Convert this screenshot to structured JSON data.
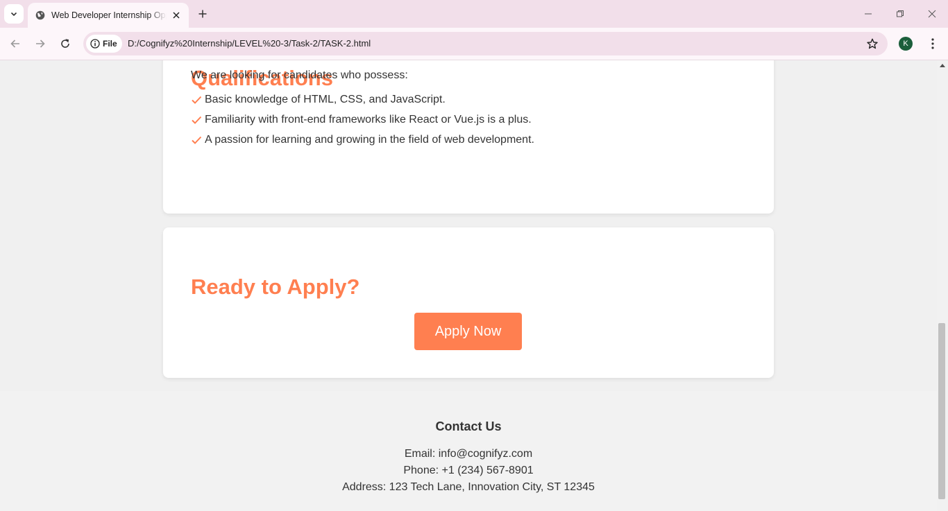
{
  "browser": {
    "tab_title": "Web Developer Internship Opportunity",
    "site_chip": "File",
    "url": "D:/Cognifyz%20Internship/LEVEL%20-3/Task-2/TASK-2.html",
    "profile_initial": "K"
  },
  "qualifications": {
    "title": "Qualifications",
    "intro": "We are looking for candidates who possess:",
    "items": [
      "Basic knowledge of HTML, CSS, and JavaScript.",
      "Familiarity with front-end frameworks like React or Vue.js is a plus.",
      "A passion for learning and growing in the field of web development."
    ]
  },
  "apply": {
    "title": "Ready to Apply?",
    "button_label": "Apply Now"
  },
  "footer": {
    "title": "Contact Us",
    "email": "Email: info@cognifyz.com",
    "phone": "Phone: +1 (234) 567-8901",
    "address": "Address: 123 Tech Lane, Innovation City, ST 12345"
  },
  "colors": {
    "accent": "#ff7f50",
    "tabbar": "#f2dfea",
    "page_bg": "#f0f0f0"
  }
}
